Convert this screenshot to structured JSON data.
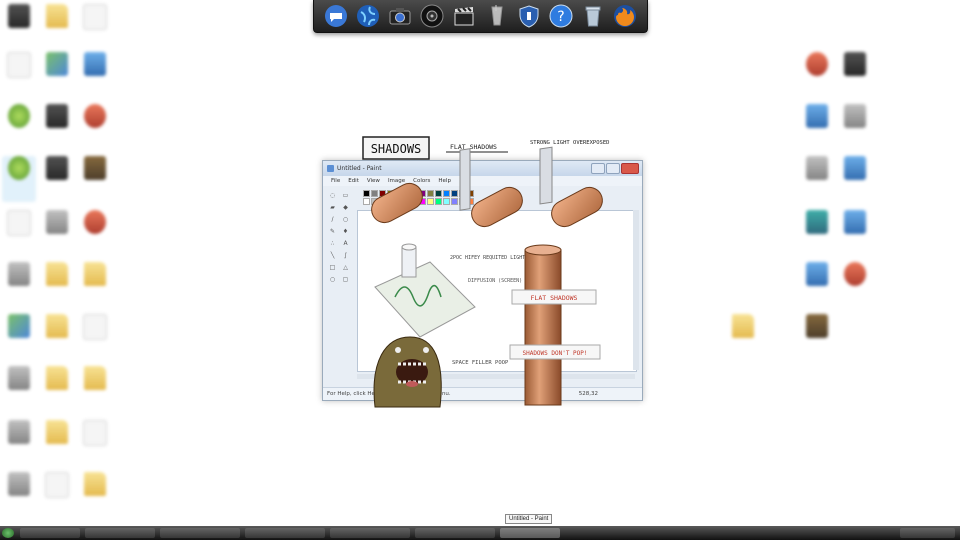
{
  "dock": {
    "items": [
      {
        "name": "messenger-icon"
      },
      {
        "name": "globe-icon"
      },
      {
        "name": "camera-icon"
      },
      {
        "name": "music-icon"
      },
      {
        "name": "clapper-icon"
      },
      {
        "name": "drink-glass-icon"
      },
      {
        "name": "shield-icon"
      },
      {
        "name": "help-icon"
      },
      {
        "name": "recycle-bin-icon"
      },
      {
        "name": "firefox-icon"
      }
    ]
  },
  "paint": {
    "title": "Untitled - Paint",
    "menu": [
      "File",
      "Edit",
      "View",
      "Image",
      "Colors",
      "Help"
    ],
    "status_help": "For Help, click Help Topics on the Help Menu.",
    "status_coords": "528,32",
    "palette": [
      "#000000",
      "#808080",
      "#800000",
      "#808000",
      "#008000",
      "#008080",
      "#000080",
      "#800080",
      "#808040",
      "#004040",
      "#0080ff",
      "#004080",
      "#8000ff",
      "#804000",
      "#ffffff",
      "#c0c0c0",
      "#ff0000",
      "#ffff00",
      "#00ff00",
      "#00ffff",
      "#0000ff",
      "#ff00ff",
      "#ffff80",
      "#00ff80",
      "#80ffff",
      "#8080ff",
      "#ff0080",
      "#ff8040"
    ]
  },
  "sketch": {
    "title": "SHADOWS",
    "flat_shadows_heading": "FLAT SHADOWS",
    "strong_light": "STRONG LIGHT OVEREXPOSED",
    "note_hifey": "2POC HIFEY REQUITED LIGHT FROM GROUND",
    "note_diffusion": "DIFFUSION (SCREEN)",
    "label_flat_shadows": "FLAT SHADOWS",
    "label_dont_pop": "SHADOWS DON'T POP!",
    "note_space": "SPACE FILLER POOP"
  },
  "taskbar": {
    "tooltip": "Untitled - Paint"
  },
  "colors": {
    "dock_bg": "#2a2a2a",
    "accent_red": "#c0392b",
    "cylinder": "#d08a5a"
  }
}
